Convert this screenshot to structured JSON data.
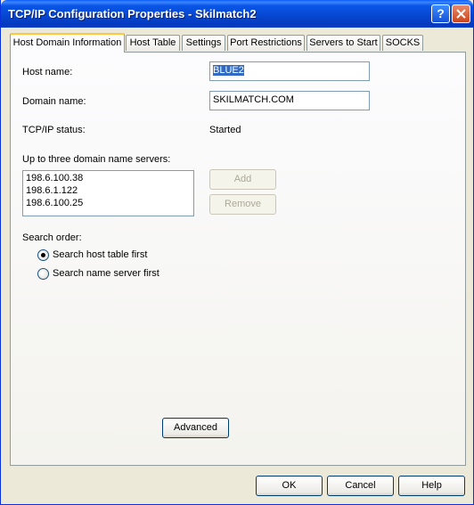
{
  "window": {
    "title": "TCP/IP Configuration Properties - Skilmatch2"
  },
  "tabs": [
    {
      "label": "Host Domain Information",
      "active": true
    },
    {
      "label": "Host Table"
    },
    {
      "label": "Settings"
    },
    {
      "label": "Port Restrictions"
    },
    {
      "label": "Servers to Start"
    },
    {
      "label": "SOCKS"
    }
  ],
  "host_domain": {
    "host_name_label": "Host name:",
    "host_name_value": "BLUE2",
    "domain_name_label": "Domain name:",
    "domain_name_value": "SKILMATCH.COM",
    "tcpip_status_label": "TCP/IP status:",
    "tcpip_status_value": "Started",
    "dns_label": "Up to three domain name servers:",
    "dns_servers": [
      "198.6.100.38",
      "198.6.1.122",
      "198.6.100.25"
    ],
    "add_label": "Add",
    "remove_label": "Remove",
    "search_order_label": "Search order:",
    "search_options": [
      "Search host table first",
      "Search name server first"
    ],
    "advanced_label": "Advanced"
  },
  "footer": {
    "ok_label": "OK",
    "cancel_label": "Cancel",
    "help_label": "Help"
  }
}
